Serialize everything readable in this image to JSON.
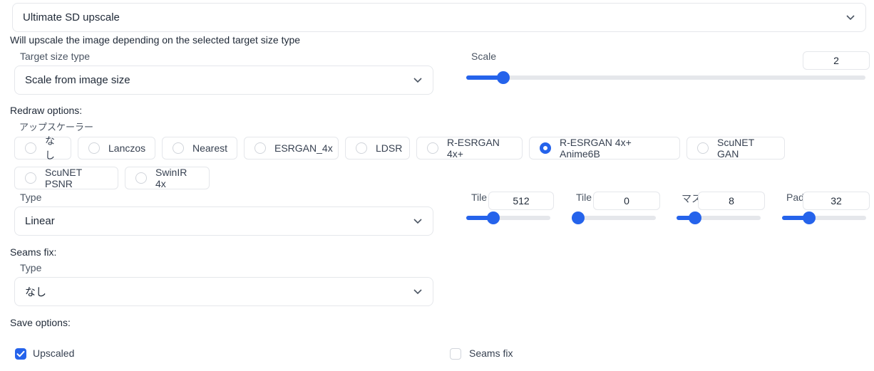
{
  "script_select": {
    "value": "Ultimate SD upscale"
  },
  "info_text": "Will upscale the image depending on the selected target size type",
  "target_size": {
    "label": "Target size type",
    "value": "Scale from image size"
  },
  "scale": {
    "label": "Scale",
    "value": "2",
    "slider_fraction": 0.08
  },
  "redraw": {
    "title": "Redraw options:",
    "upscaler_label": "アップスケーラー",
    "upscalers": [
      "なし",
      "Lanczos",
      "Nearest",
      "ESRGAN_4x",
      "LDSR",
      "R-ESRGAN 4x+",
      "R-ESRGAN 4x+ Anime6B",
      "ScuNET GAN",
      "ScuNET PSNR",
      "SwinIR 4x"
    ],
    "selected": "R-ESRGAN 4x+ Anime6B",
    "type": {
      "label": "Type",
      "value": "Linear"
    },
    "tile_width": {
      "label": "Tile",
      "value": "512",
      "slider_fraction": 0.29
    },
    "tile_height": {
      "label": "Tile",
      "value": "0",
      "slider_fraction": 0.0
    },
    "mask_blur": {
      "label": "マス",
      "value": "8",
      "slider_fraction": 0.17
    },
    "padding": {
      "label": "Pad",
      "value": "32",
      "slider_fraction": 0.29
    }
  },
  "seams": {
    "title": "Seams fix:",
    "type_label": "Type",
    "type_value": "なし"
  },
  "save": {
    "title": "Save options:",
    "upscaled": {
      "label": "Upscaled",
      "checked": true
    },
    "seams_fix": {
      "label": "Seams fix",
      "checked": false
    }
  },
  "colors": {
    "accent": "#2563eb",
    "border": "#e5e7eb"
  }
}
